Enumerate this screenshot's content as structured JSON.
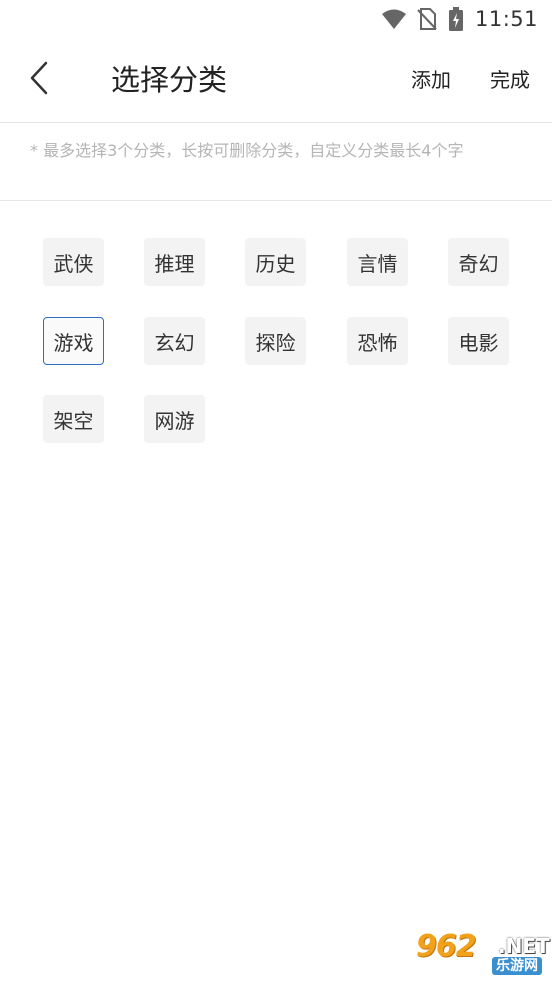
{
  "status_bar": {
    "time": "11:51",
    "icons": [
      "wifi-icon",
      "no-sim-icon",
      "battery-charging-icon"
    ]
  },
  "app_bar": {
    "back_icon": "chevron-left-icon",
    "title": "选择分类",
    "add_label": "添加",
    "done_label": "完成"
  },
  "hint": "* 最多选择3个分类，长按可删除分类，自定义分类最长4个字",
  "tags": [
    {
      "label": "武侠",
      "selected": false
    },
    {
      "label": "推理",
      "selected": false
    },
    {
      "label": "历史",
      "selected": false
    },
    {
      "label": "言情",
      "selected": false
    },
    {
      "label": "奇幻",
      "selected": false
    },
    {
      "label": "游戏",
      "selected": true
    },
    {
      "label": "玄幻",
      "selected": false
    },
    {
      "label": "探险",
      "selected": false
    },
    {
      "label": "恐怖",
      "selected": false
    },
    {
      "label": "电影",
      "selected": false
    },
    {
      "label": "架空",
      "selected": false
    },
    {
      "label": "网游",
      "selected": false
    }
  ],
  "colors": {
    "selected_border": "#2c6fbf",
    "tag_background": "#f3f3f3",
    "hint_text": "#b5b5b5"
  },
  "watermark": {
    "number": "962",
    "suffix": ".NET",
    "sub": "乐游网"
  }
}
